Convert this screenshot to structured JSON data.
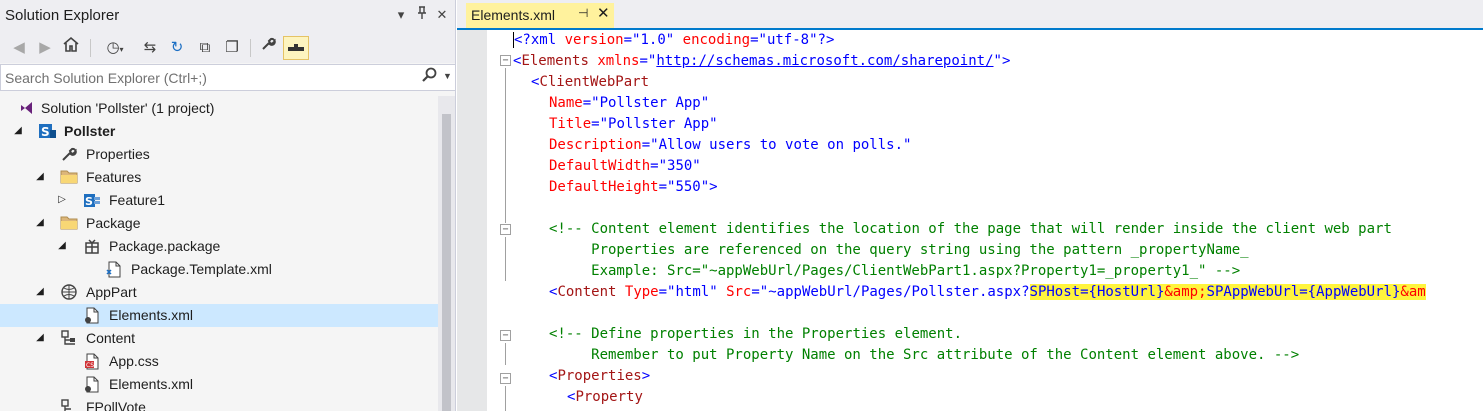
{
  "solution_explorer": {
    "title": "Solution Explorer",
    "controls": {
      "dropdown": "▾",
      "pin": "⊓",
      "close": "✕"
    },
    "toolbar": {
      "icons": [
        "back-icon",
        "forward-icon",
        "home-icon",
        "history-icon",
        "sync-icon",
        "refresh-icon",
        "collapse-all-icon",
        "show-all-files-icon",
        "properties-icon",
        "preview-icon"
      ]
    },
    "search": {
      "placeholder": "Search Solution Explorer (Ctrl+;)",
      "value": ""
    },
    "tree": [
      {
        "label": "Solution 'Pollster' (1 project)",
        "icon": "visual-studio-solution-icon",
        "expander": ""
      },
      {
        "label": "Pollster",
        "icon": "sharepoint-project-icon",
        "expander": "expanded",
        "bold": true
      },
      {
        "label": "Properties",
        "icon": "wrench-icon",
        "expander": ""
      },
      {
        "label": "Features",
        "icon": "folder-icon",
        "expander": "expanded"
      },
      {
        "label": "Feature1",
        "icon": "feature-icon",
        "expander": "collapsed"
      },
      {
        "label": "Package",
        "icon": "folder-icon",
        "expander": "expanded"
      },
      {
        "label": "Package.package",
        "icon": "package-icon",
        "expander": "expanded"
      },
      {
        "label": "Package.Template.xml",
        "icon": "xml-file-icon",
        "expander": ""
      },
      {
        "label": "AppPart",
        "icon": "app-part-icon",
        "expander": "expanded"
      },
      {
        "label": "Elements.xml",
        "icon": "xml-file-icon",
        "expander": "",
        "selected": true
      },
      {
        "label": "Content",
        "icon": "module-icon",
        "expander": "expanded"
      },
      {
        "label": "App.css",
        "icon": "css-file-icon",
        "expander": ""
      },
      {
        "label": "Elements.xml",
        "icon": "xml-file-icon",
        "expander": ""
      },
      {
        "label": "FPollVote",
        "icon": "module-icon",
        "expander": ""
      }
    ]
  },
  "editor": {
    "tab": {
      "label": "Elements.xml",
      "pin": "⊣",
      "close": "✕"
    },
    "code": {
      "l1_pi_open": "<?xml",
      "l1_attr1": "version",
      "l1_val1": "\"1.0\"",
      "l1_attr2": "encoding",
      "l1_val2": "\"utf-8\"",
      "l1_pi_close": "?>",
      "l2_open": "<",
      "l2_el": "Elements",
      "l2_attr": "xmlns",
      "l2_q1": "\"",
      "l2_url": "http://schemas.microsoft.com/sharepoint/",
      "l2_q2": "\"",
      "l2_close": ">",
      "l3_open": "<",
      "l3_el": "ClientWebPart",
      "l4_attr": "Name",
      "l4_val": "\"Pollster App\"",
      "l5_attr": "Title",
      "l5_val": "\"Pollster App\"",
      "l6_attr": "Description",
      "l6_val": "\"Allow users to vote on polls.\"",
      "l7_attr": "DefaultWidth",
      "l7_val": "\"350\"",
      "l8_attr": "DefaultHeight",
      "l8_val": "\"550\"",
      "l8_close": ">",
      "l10_com_open": "<!--",
      "l10_text": " Content element identifies the location of the page that will render inside the client web part",
      "l11_text": "     Properties are referenced on the query string using the pattern _propertyName_",
      "l12_text": "     Example: Src=\"~appWebUrl/Pages/ClientWebPart1.aspx?Property1=_property1_\" ",
      "l12_com_close": "-->",
      "l13_open": "<",
      "l13_el": "Content",
      "l13_attr1": "Type",
      "l13_val1": "\"html\"",
      "l13_attr2": "Src",
      "l13_val2": "\"~appWebUrl/Pages/Pollster.aspx?",
      "l13_hl1": "SPHost={HostUrl}",
      "l13_ent": "&amp;",
      "l13_hl2": "SPAppWebUrl={AppWebUrl}",
      "l13_tail": "&am",
      "l15_com_open": "<!--",
      "l15_text": " Define properties in the Properties element.",
      "l16_text": "     Remember to put Property Name on the Src attribute of the Content element above. ",
      "l16_com_close": "-->",
      "l17_open": "<",
      "l17_el": "Properties",
      "l17_close": ">",
      "l18_open": "<",
      "l18_el": "Property"
    }
  }
}
